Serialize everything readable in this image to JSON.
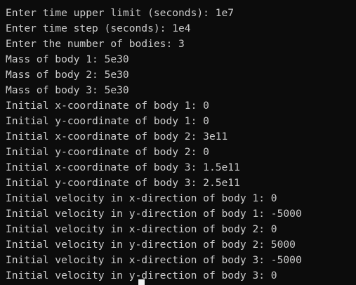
{
  "terminal": {
    "lines": [
      "Enter time upper limit (seconds): 1e7",
      "Enter time step (seconds): 1e4",
      "Enter the number of bodies: 3",
      "Mass of body 1: 5e30",
      "Mass of body 2: 5e30",
      "Mass of body 3: 5e30",
      "Initial x-coordinate of body 1: 0",
      "Initial y-coordinate of body 1: 0",
      "Initial x-coordinate of body 2: 3e11",
      "Initial y-coordinate of body 2: 0",
      "Initial x-coordinate of body 3: 1.5e11",
      "Initial y-coordinate of body 3: 2.5e11",
      "Initial velocity in x-direction of body 1: 0",
      "Initial velocity in y-direction of body 1: -5000",
      "Initial velocity in x-direction of body 2: 0",
      "Initial velocity in y-direction of body 2: 5000",
      "Initial velocity in x-direction of body 3: -5000",
      "Initial velocity in y-direction of body 3: 0"
    ],
    "partial_top_line_plain": "",
    "partial_top_line_highlight": "",
    "partial_bottom_line": "",
    "colors": {
      "background": "#0c0c0c",
      "text": "#cccccc",
      "cursor": "#f0f0f0",
      "highlight": "#e8b04a"
    }
  }
}
